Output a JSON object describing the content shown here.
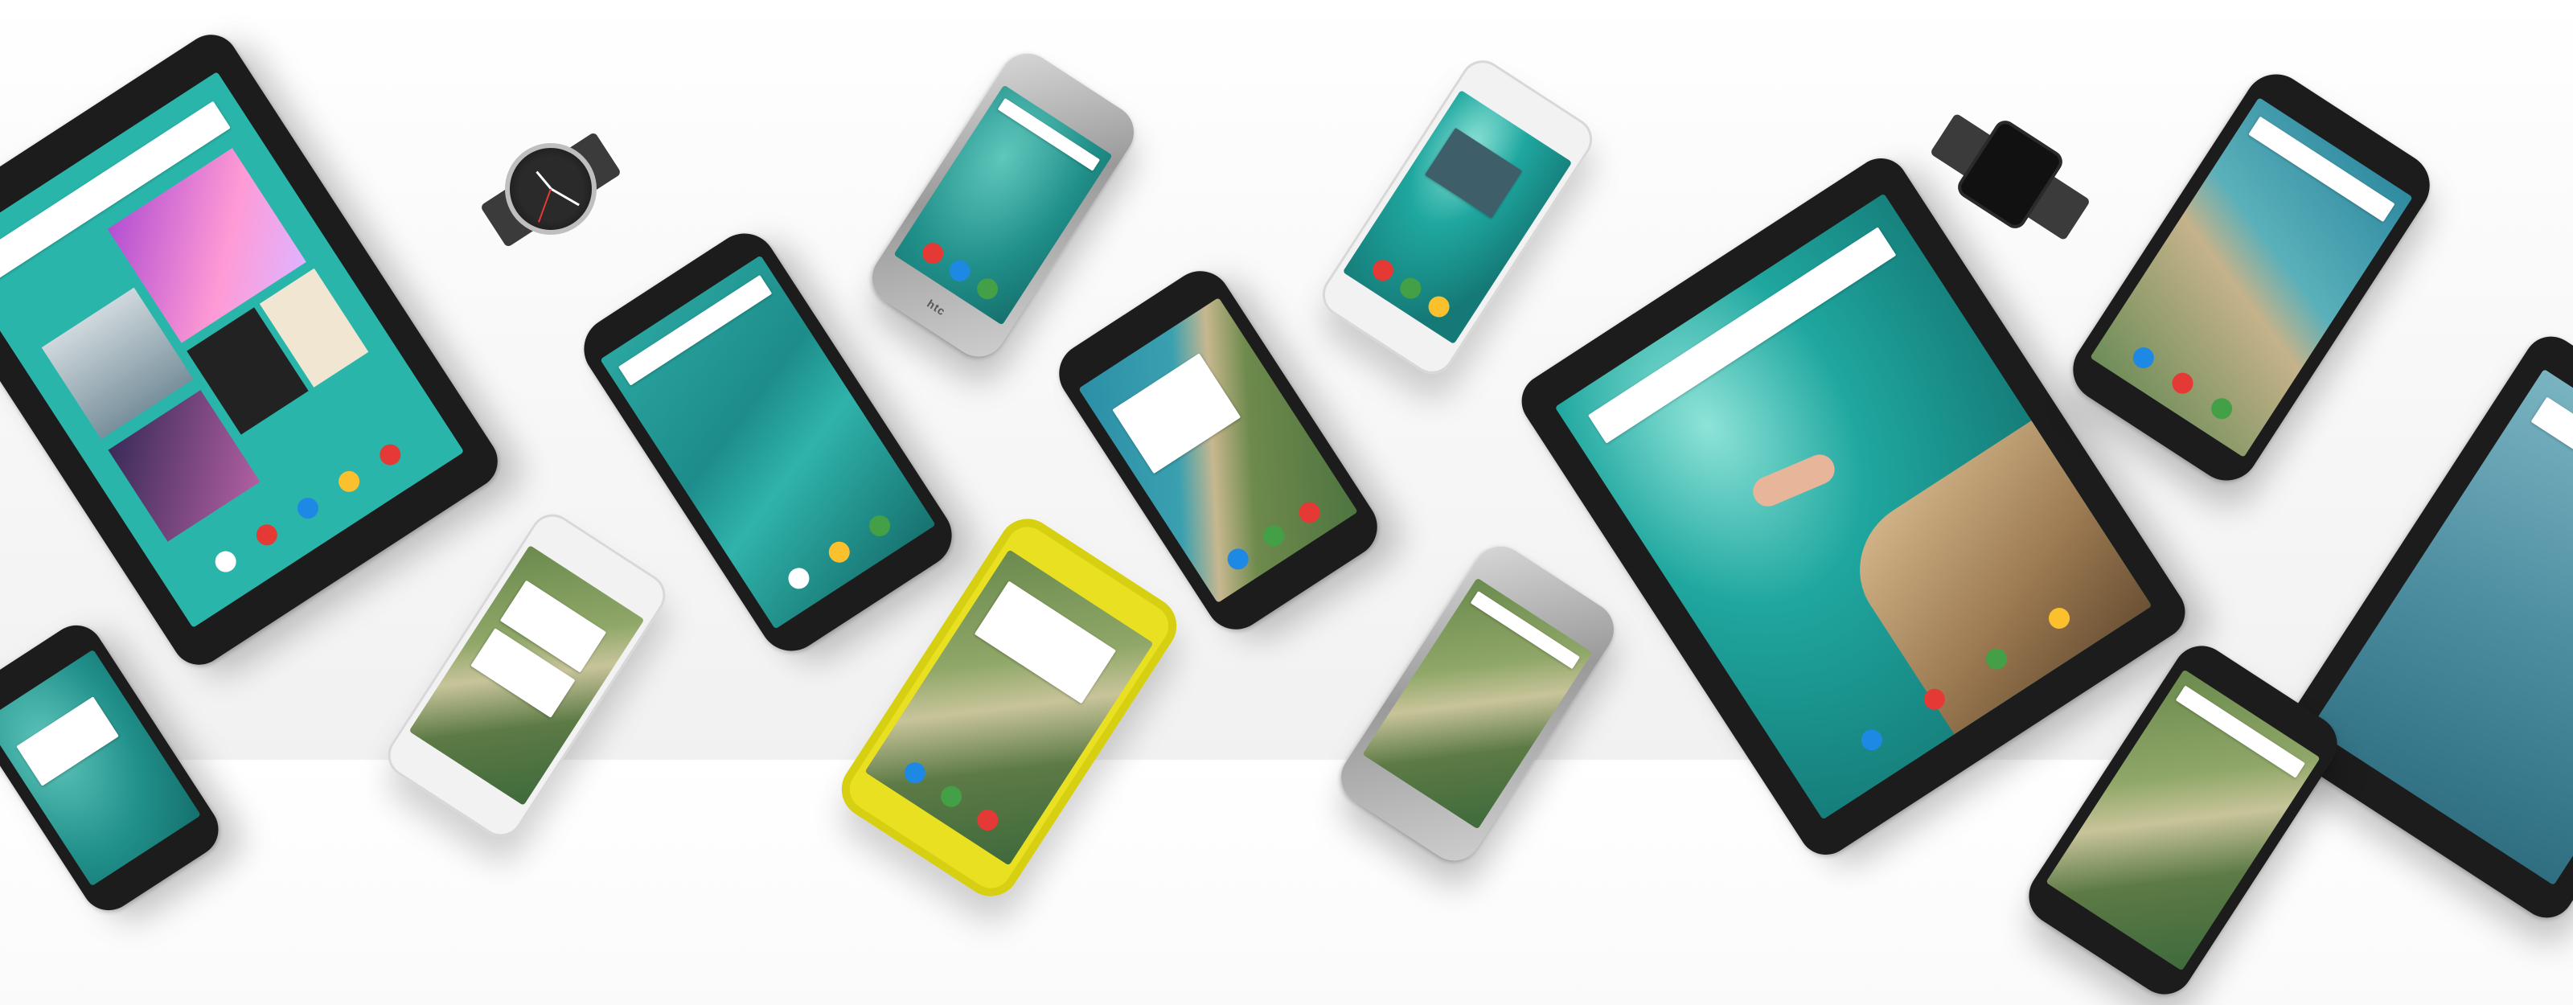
{
  "scene": {
    "devices": [
      {
        "name": "tablet-music",
        "screen": "music"
      },
      {
        "name": "phone-water",
        "screen": "water"
      },
      {
        "name": "phone-htc",
        "screen": "teal",
        "brand": "htc"
      },
      {
        "name": "phone-moto",
        "screen": "coast"
      },
      {
        "name": "phone-samsung-top",
        "screen": "pool"
      },
      {
        "name": "tablet-diver",
        "screen": "pool"
      },
      {
        "name": "phone-right-top",
        "screen": "beach"
      },
      {
        "name": "tablet-far-right",
        "screen": "sea"
      },
      {
        "name": "phone-bottom-left",
        "screen": "teal"
      },
      {
        "name": "phone-samsung-bottom",
        "screen": "earth"
      },
      {
        "name": "phone-yellow",
        "screen": "earth"
      },
      {
        "name": "phone-htc-bottom",
        "screen": "earth"
      },
      {
        "name": "phone-bottom-right",
        "screen": "earth"
      }
    ],
    "watches": [
      {
        "name": "moto-360-watch",
        "shape": "round"
      },
      {
        "name": "lg-g-watch",
        "shape": "square",
        "time": "",
        "date": ""
      }
    ],
    "colors": {
      "teal": "#21908a",
      "background": "#f7f7f7",
      "yellow_phone": "#e8e021"
    }
  }
}
